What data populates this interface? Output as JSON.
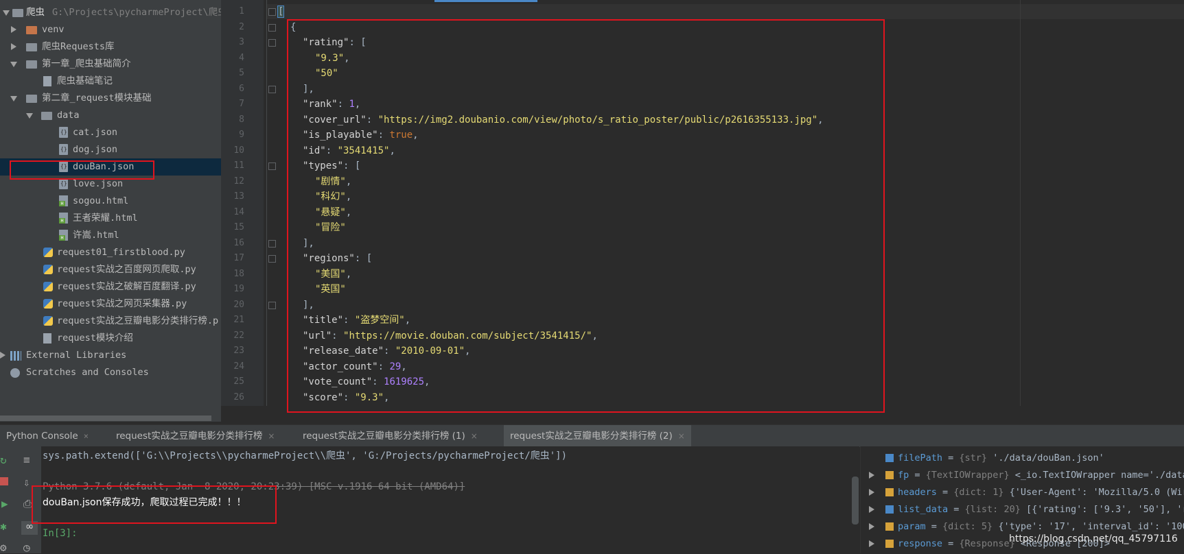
{
  "project": {
    "root_name": "爬虫",
    "root_path": "G:\\Projects\\pycharmeProject\\爬虫",
    "items": [
      {
        "label": "venv"
      },
      {
        "label": "爬虫Requests库"
      },
      {
        "label": "第一章_爬虫基础简介"
      },
      {
        "label": "爬虫基础笔记"
      },
      {
        "label": "第二章_request模块基础"
      },
      {
        "label": "data"
      },
      {
        "label": "cat.json"
      },
      {
        "label": "dog.json"
      },
      {
        "label": "douBan.json"
      },
      {
        "label": "love.json"
      },
      {
        "label": "sogou.html"
      },
      {
        "label": "王者荣耀.html"
      },
      {
        "label": "许嵩.html"
      },
      {
        "label": "request01_firstblood.py"
      },
      {
        "label": "request实战之百度网页爬取.py"
      },
      {
        "label": "request实战之破解百度翻译.py"
      },
      {
        "label": "request实战之网页采集器.py"
      },
      {
        "label": "request实战之豆瓣电影分类排行榜.p"
      },
      {
        "label": "request模块介绍"
      },
      {
        "label": "External Libraries"
      },
      {
        "label": "Scratches and Consoles"
      }
    ]
  },
  "editor": {
    "line_numbers": [
      "1",
      "2",
      "3",
      "4",
      "5",
      "6",
      "7",
      "8",
      "9",
      "10",
      "11",
      "12",
      "13",
      "14",
      "15",
      "16",
      "17",
      "18",
      "19",
      "20",
      "21",
      "22",
      "23",
      "24",
      "25",
      "26"
    ],
    "lines": {
      "l1": "[",
      "l2": "{",
      "l3_key": "\"rating\"",
      "l3_rest": ": [",
      "l4": "\"9.3\"",
      "l5": "\"50\"",
      "l6": "],",
      "l7_key": "\"rank\"",
      "l7_val": "1",
      "l8_key": "\"cover_url\"",
      "l8_val": "\"https://img2.doubanio.com/view/photo/s_ratio_poster/public/p2616355133.jpg\"",
      "l9_key": "\"is_playable\"",
      "l9_val": "true",
      "l10_key": "\"id\"",
      "l10_val": "\"3541415\"",
      "l11_key": "\"types\"",
      "l11_rest": ": [",
      "l12": "\"剧情\"",
      "l13": "\"科幻\"",
      "l14": "\"悬疑\"",
      "l15": "\"冒险\"",
      "l16": "],",
      "l17_key": "\"regions\"",
      "l17_rest": ": [",
      "l18": "\"美国\"",
      "l19": "\"英国\"",
      "l20": "],",
      "l21_key": "\"title\"",
      "l21_val": "\"盗梦空间\"",
      "l22_key": "\"url\"",
      "l22_val": "\"https://movie.douban.com/subject/3541415/\"",
      "l23_key": "\"release_date\"",
      "l23_val": "\"2010-09-01\"",
      "l24_key": "\"actor_count\"",
      "l24_val": "29",
      "l25_key": "\"vote_count\"",
      "l25_val": "1619625",
      "l26_key": "\"score\"",
      "l26_val": "\"9.3\""
    }
  },
  "console": {
    "tabs": [
      {
        "label": "Python Console"
      },
      {
        "label": "request实战之豆瓣电影分类排行榜"
      },
      {
        "label": "request实战之豆瓣电影分类排行榜 (1)"
      },
      {
        "label": "request实战之豆瓣电影分类排行榜 (2)"
      }
    ],
    "close_glyph": "×",
    "lines": {
      "sys_path": "sys.path.extend(['G:\\\\Projects\\\\pycharmeProject\\\\爬虫', 'G:/Projects/pycharmeProject/爬虫'])",
      "python_version": "Python 3.7.6 (default, Jan  8 2020, 20:23:39) [MSC v.1916 64 bit (AMD64)]",
      "output": "douBan.json保存成功，爬取过程已完成！！！",
      "prompt": "In[3]:"
    }
  },
  "variables": [
    {
      "name": "filePath",
      "type": "{str}",
      "value": "'./data/douBan.json'"
    },
    {
      "name": "fp",
      "type": "{TextIOWrapper}",
      "value": "<_io.TextIOWrapper name='./data"
    },
    {
      "name": "headers",
      "type": "{dict: 1}",
      "value": "{'User-Agent': 'Mozilla/5.0 (Wir"
    },
    {
      "name": "list_data",
      "type": "{list: 20}",
      "value": "[{'rating': ['9.3', '50'], 'r"
    },
    {
      "name": "param",
      "type": "{dict: 5}",
      "value": "{'type': '17', 'interval_id': '100"
    },
    {
      "name": "response",
      "type": "{Response}",
      "value": "<Response [200]>"
    }
  ],
  "watermark": "https://blog.csdn.net/qq_45797116",
  "colors": {
    "accent": "#4a88c7",
    "annotation_red": "#e0141e",
    "selection": "#0d293e"
  }
}
